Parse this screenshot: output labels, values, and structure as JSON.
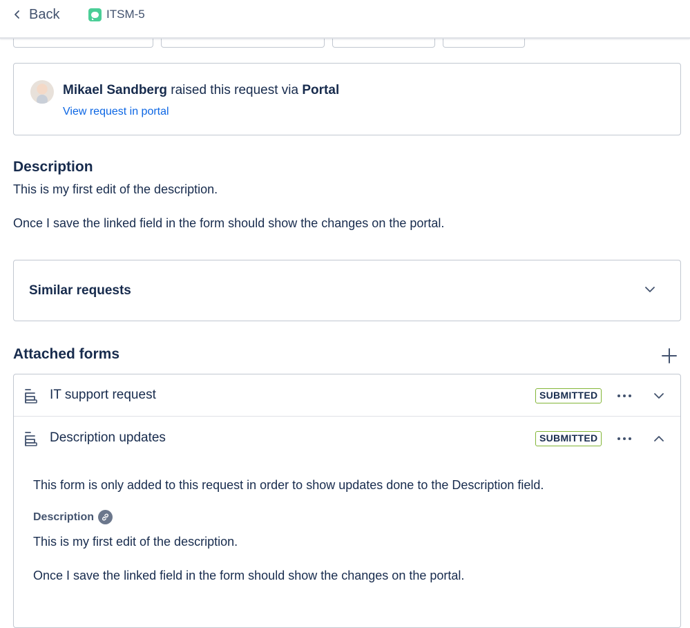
{
  "header": {
    "back_label": "Back",
    "issue_key": "ITSM-5"
  },
  "raised": {
    "reporter": "Mikael Sandberg",
    "middle_text": " raised this request via ",
    "channel": "Portal",
    "view_link": "View request in portal"
  },
  "description": {
    "heading": "Description",
    "paragraphs": [
      "This is my first edit of the description.",
      "Once I save the linked field in the form should show the changes on the portal."
    ]
  },
  "similar_requests": {
    "label": "Similar requests"
  },
  "attached_forms": {
    "heading": "Attached forms",
    "forms": [
      {
        "title": "IT support request",
        "status": "SUBMITTED",
        "expanded": false
      },
      {
        "title": "Description updates",
        "status": "SUBMITTED",
        "expanded": true
      }
    ],
    "expanded_form": {
      "intro": "This form is only added to this request in order to show updates done to the Description field.",
      "field_label": "Description",
      "field_paragraphs": [
        "This is my first edit of the description.",
        "Once I save the linked field in the form should show the changes on the portal."
      ]
    }
  },
  "colors": {
    "link": "#0c66e4",
    "badge_border": "#82b536",
    "text": "#172b4d",
    "issue_icon": "#4bce97"
  }
}
